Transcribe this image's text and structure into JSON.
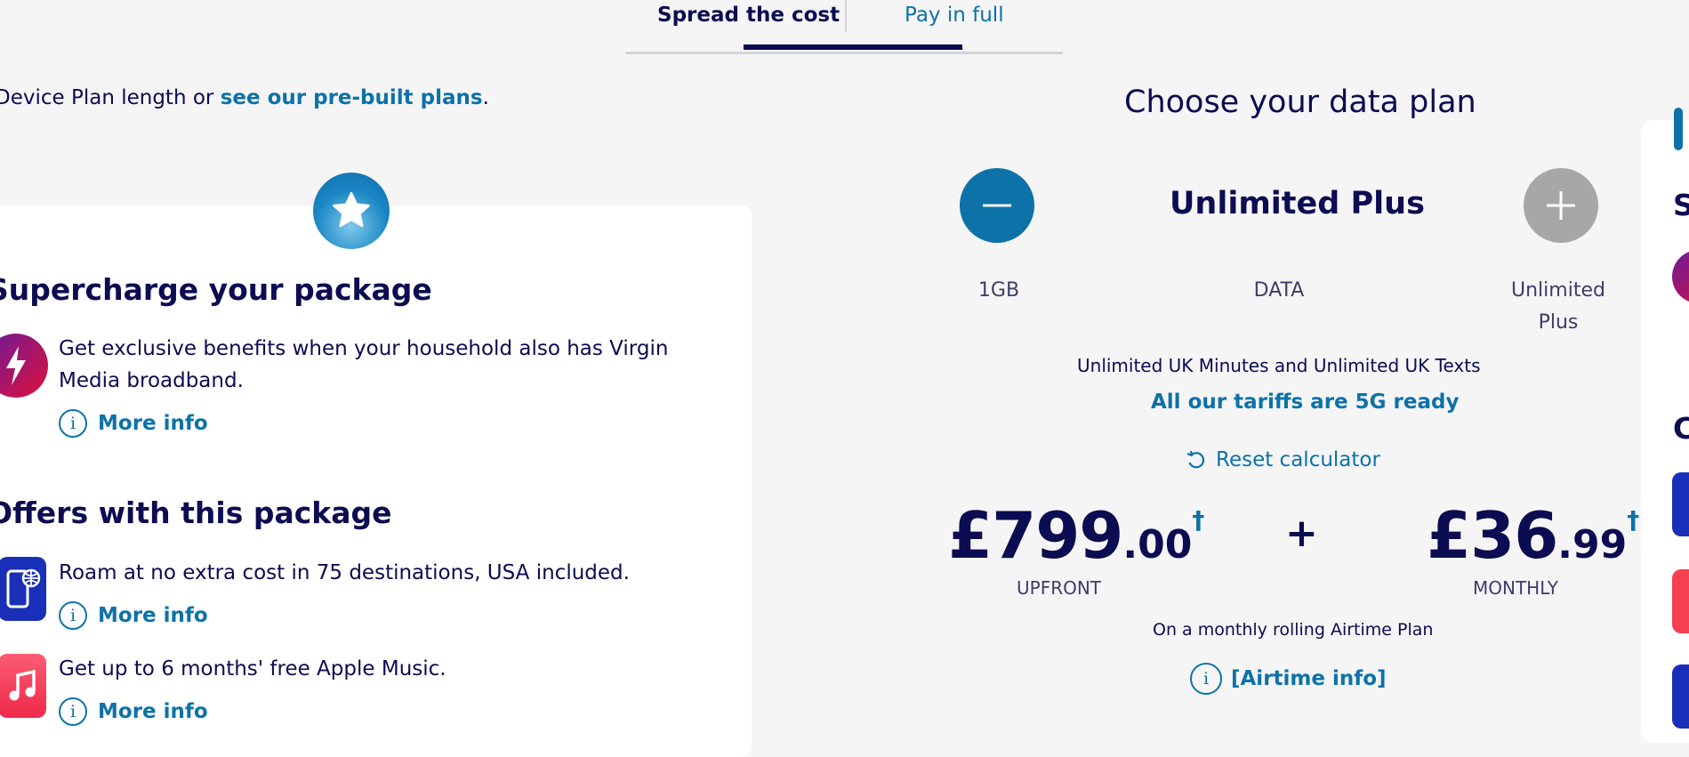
{
  "tabs": {
    "spread": "Spread the cost",
    "full": "Pay in full"
  },
  "intro": {
    "prefix": "Device Plan length or ",
    "link": "see our pre-built plans",
    "suffix": "."
  },
  "supercharge": {
    "heading": "Supercharge your package",
    "text": "Get exclusive benefits when your household also has Virgin Media broadband.",
    "more_info": "More info",
    "info_glyph": "i"
  },
  "offers": {
    "heading": "Offers with this package",
    "items": [
      {
        "text": "Roam at no extra cost in 75 destinations, USA included.",
        "more_info": "More info",
        "icon": "roaming-phone-icon"
      },
      {
        "text": "Get up to 6 months' free Apple Music.",
        "more_info": "More info",
        "icon": "apple-music-icon"
      }
    ]
  },
  "data_plan": {
    "title": "Choose your data plan",
    "plan_name": "Unlimited Plus",
    "min_label": "1GB",
    "mid_label": "DATA",
    "max_label_line1": "Unlimited",
    "max_label_line2": "Plus",
    "minutes_text": "Unlimited UK Minutes and Unlimited UK Texts",
    "fiveg_text": "All our tariffs are 5G ready",
    "reset_label": "Reset calculator",
    "upfront": {
      "whole": "£799",
      "cents": ".00",
      "dagger": "†",
      "label": "UPFRONT"
    },
    "plus": "+",
    "monthly": {
      "whole": "£36",
      "cents": ".99",
      "dagger": "†",
      "label": "MONTHLY"
    },
    "rolling_text": "On a monthly rolling Airtime Plan",
    "airtime_info": "[Airtime info]"
  },
  "right_panel": {
    "heading_initial": "S",
    "subheading_initial": "C"
  },
  "colors": {
    "navy": "#0c0c52",
    "blue": "#0d72a8",
    "grey_button": "#a7a7a7",
    "background": "#f5f5f6"
  }
}
